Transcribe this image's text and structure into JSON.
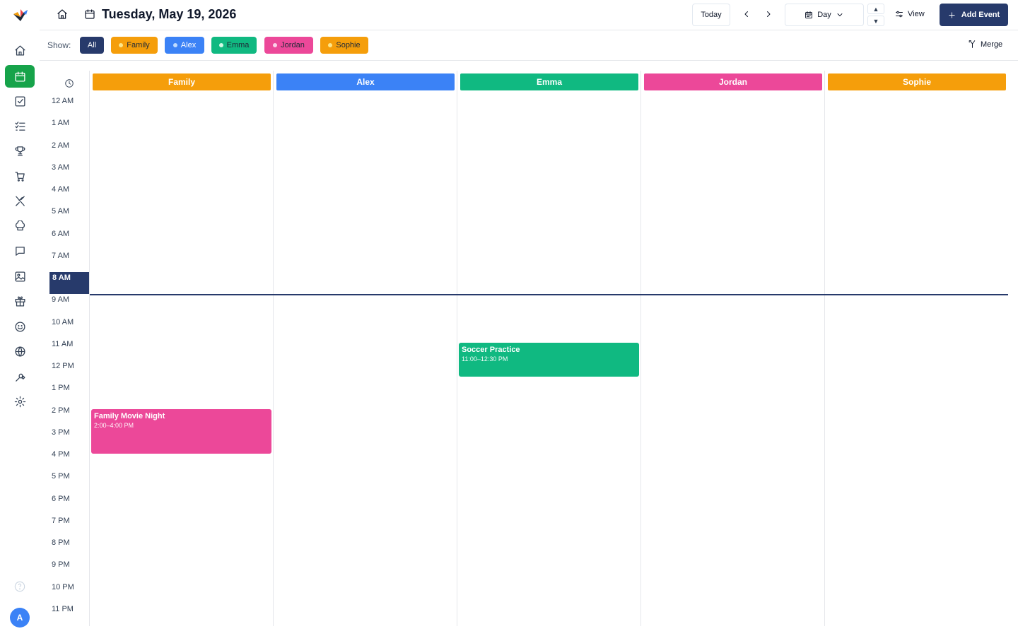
{
  "sidebar": {
    "items": [
      {
        "name": "home-icon"
      },
      {
        "name": "calendar-icon"
      },
      {
        "name": "checkbox-icon"
      },
      {
        "name": "checklist-icon"
      },
      {
        "name": "trophy-icon"
      },
      {
        "name": "cart-icon"
      },
      {
        "name": "utensils-icon"
      },
      {
        "name": "chef-hat-icon"
      },
      {
        "name": "chat-icon"
      },
      {
        "name": "image-icon"
      },
      {
        "name": "gift-icon"
      },
      {
        "name": "smiley-icon"
      },
      {
        "name": "globe-icon"
      },
      {
        "name": "wrench-icon"
      },
      {
        "name": "settings-icon"
      }
    ],
    "active_index": 1,
    "avatar_initial": "A"
  },
  "header": {
    "title": "Tuesday, May 19, 2026",
    "today_label": "Today",
    "view_mode": "Day",
    "step_up": "▲",
    "step_down": "▼",
    "view_label": "View",
    "add_event_label": "Add Event"
  },
  "filters": {
    "show_label": "Show:",
    "chips": [
      {
        "label": "All",
        "color": "#273a6b",
        "text_color": "#ffffff",
        "dot": false
      },
      {
        "label": "Family",
        "color": "#f59e0b",
        "text_color": "#1f2937",
        "dot": true
      },
      {
        "label": "Alex",
        "color": "#3b82f6",
        "text_color": "#ffffff",
        "dot": true
      },
      {
        "label": "Emma",
        "color": "#10b981",
        "text_color": "#1f2937",
        "dot": true
      },
      {
        "label": "Jordan",
        "color": "#ec4899",
        "text_color": "#1f2937",
        "dot": true
      },
      {
        "label": "Sophie",
        "color": "#f59e0b",
        "text_color": "#1f2937",
        "dot": true
      }
    ],
    "merge_label": "Merge"
  },
  "calendar": {
    "hours": [
      "12 AM",
      "1 AM",
      "2 AM",
      "3 AM",
      "4 AM",
      "5 AM",
      "6 AM",
      "7 AM",
      "8 AM",
      "9 AM",
      "10 AM",
      "11 AM",
      "12 PM",
      "1 PM",
      "2 PM",
      "3 PM",
      "4 PM",
      "5 PM",
      "6 PM",
      "7 PM",
      "8 PM",
      "9 PM",
      "10 PM",
      "11 PM"
    ],
    "current_hour_index": 8,
    "current_time_hour": 8.55,
    "columns": [
      {
        "name": "Family",
        "color": "#f59e0b"
      },
      {
        "name": "Alex",
        "color": "#3b82f6"
      },
      {
        "name": "Emma",
        "color": "#10b981"
      },
      {
        "name": "Jordan",
        "color": "#ec4899"
      },
      {
        "name": "Sophie",
        "color": "#f59e0b"
      }
    ],
    "events": [
      {
        "column": 2,
        "title": "Soccer Practice",
        "time": "11:00–12:30 PM",
        "start_hour": 11.0,
        "end_hour": 12.5,
        "color": "#10b981"
      },
      {
        "column": 0,
        "title": "Family Movie Night",
        "time": "2:00–4:00 PM",
        "start_hour": 14.0,
        "end_hour": 16.0,
        "color": "#ec4899"
      }
    ]
  }
}
